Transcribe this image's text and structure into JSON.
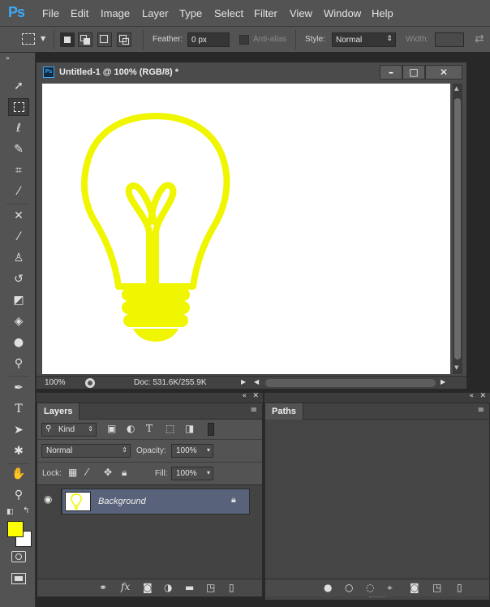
{
  "app": {
    "logo": "Ps",
    "accent": "#3ea8f5"
  },
  "menu": {
    "items": [
      "File",
      "Edit",
      "Image",
      "Layer",
      "Type",
      "Select",
      "Filter",
      "View",
      "Window",
      "Help"
    ]
  },
  "options": {
    "feather_label": "Feather:",
    "feather_value": "0 px",
    "antialias_label": "Anti-alias",
    "style_label": "Style:",
    "style_value": "Normal",
    "width_label": "Width:"
  },
  "tools": {
    "items": [
      "move-tool",
      "rectangular-marquee-tool",
      "lasso-tool",
      "quick-selection-tool",
      "crop-tool",
      "eyedropper-tool",
      "spot-healing-tool",
      "brush-tool",
      "clone-stamp-tool",
      "history-brush-tool",
      "eraser-tool",
      "paint-bucket-tool",
      "blur-tool",
      "dodge-tool",
      "pen-tool",
      "type-tool",
      "path-selection-tool",
      "custom-shape-tool",
      "hand-tool",
      "zoom-tool"
    ],
    "active": "rectangular-marquee-tool",
    "foreground_color": "#ffff00",
    "background_color": "#ffffff"
  },
  "document": {
    "title": "Untitled-1 @ 100% (RGB/8) *",
    "zoom": "100%",
    "doc_info": "Doc: 531.6K/255.9K",
    "art_color": "#f0f500"
  },
  "layers_panel": {
    "tab": "Layers",
    "filter_kind": "Kind",
    "blend_mode": "Normal",
    "opacity_label": "Opacity:",
    "opacity_value": "100%",
    "lock_label": "Lock:",
    "fill_label": "Fill:",
    "fill_value": "100%",
    "layers": [
      {
        "name": "Background",
        "visible": true,
        "locked": true
      }
    ]
  },
  "paths_panel": {
    "tab": "Paths"
  }
}
